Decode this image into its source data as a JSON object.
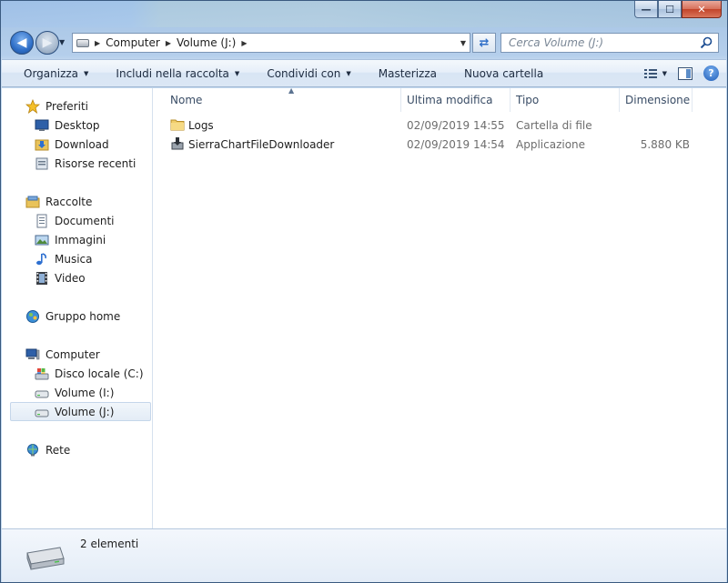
{
  "window": {
    "caption": {
      "minimize": "—",
      "maximize": "☐",
      "close": "✕"
    }
  },
  "address": {
    "crumbs": [
      "Computer",
      "Volume (J:)"
    ]
  },
  "search": {
    "placeholder": "Cerca Volume (J:)"
  },
  "commands": [
    {
      "label": "Organizza",
      "dropdown": true
    },
    {
      "label": "Includi nella raccolta",
      "dropdown": true
    },
    {
      "label": "Condividi con",
      "dropdown": true
    },
    {
      "label": "Masterizza",
      "dropdown": false
    },
    {
      "label": "Nuova cartella",
      "dropdown": false
    }
  ],
  "help_label": "?",
  "sidebar": {
    "favorites": {
      "label": "Preferiti",
      "items": [
        "Desktop",
        "Download",
        "Risorse recenti"
      ]
    },
    "libraries": {
      "label": "Raccolte",
      "items": [
        "Documenti",
        "Immagini",
        "Musica",
        "Video"
      ]
    },
    "homegroup": {
      "label": "Gruppo home"
    },
    "computer": {
      "label": "Computer",
      "items": [
        "Disco locale (C:)",
        "Volume (I:)",
        "Volume (J:)"
      ],
      "selected": "Volume (J:)"
    },
    "network": {
      "label": "Rete"
    }
  },
  "columns": {
    "name": "Nome",
    "modified": "Ultima modifica",
    "type": "Tipo",
    "size": "Dimensione"
  },
  "files": [
    {
      "name": "Logs",
      "modified": "02/09/2019 14:55",
      "type": "Cartella di file",
      "size": "",
      "icon": "folder-icon"
    },
    {
      "name": "SierraChartFileDownloader",
      "modified": "02/09/2019 14:54",
      "type": "Applicazione",
      "size": "5.880 KB",
      "icon": "application-icon"
    }
  ],
  "status": {
    "count_label": "2 elementi"
  },
  "colors": {
    "accent": "#2f6fc8",
    "command_text": "#1e2c40",
    "muted_text": "#6d6d6d"
  }
}
